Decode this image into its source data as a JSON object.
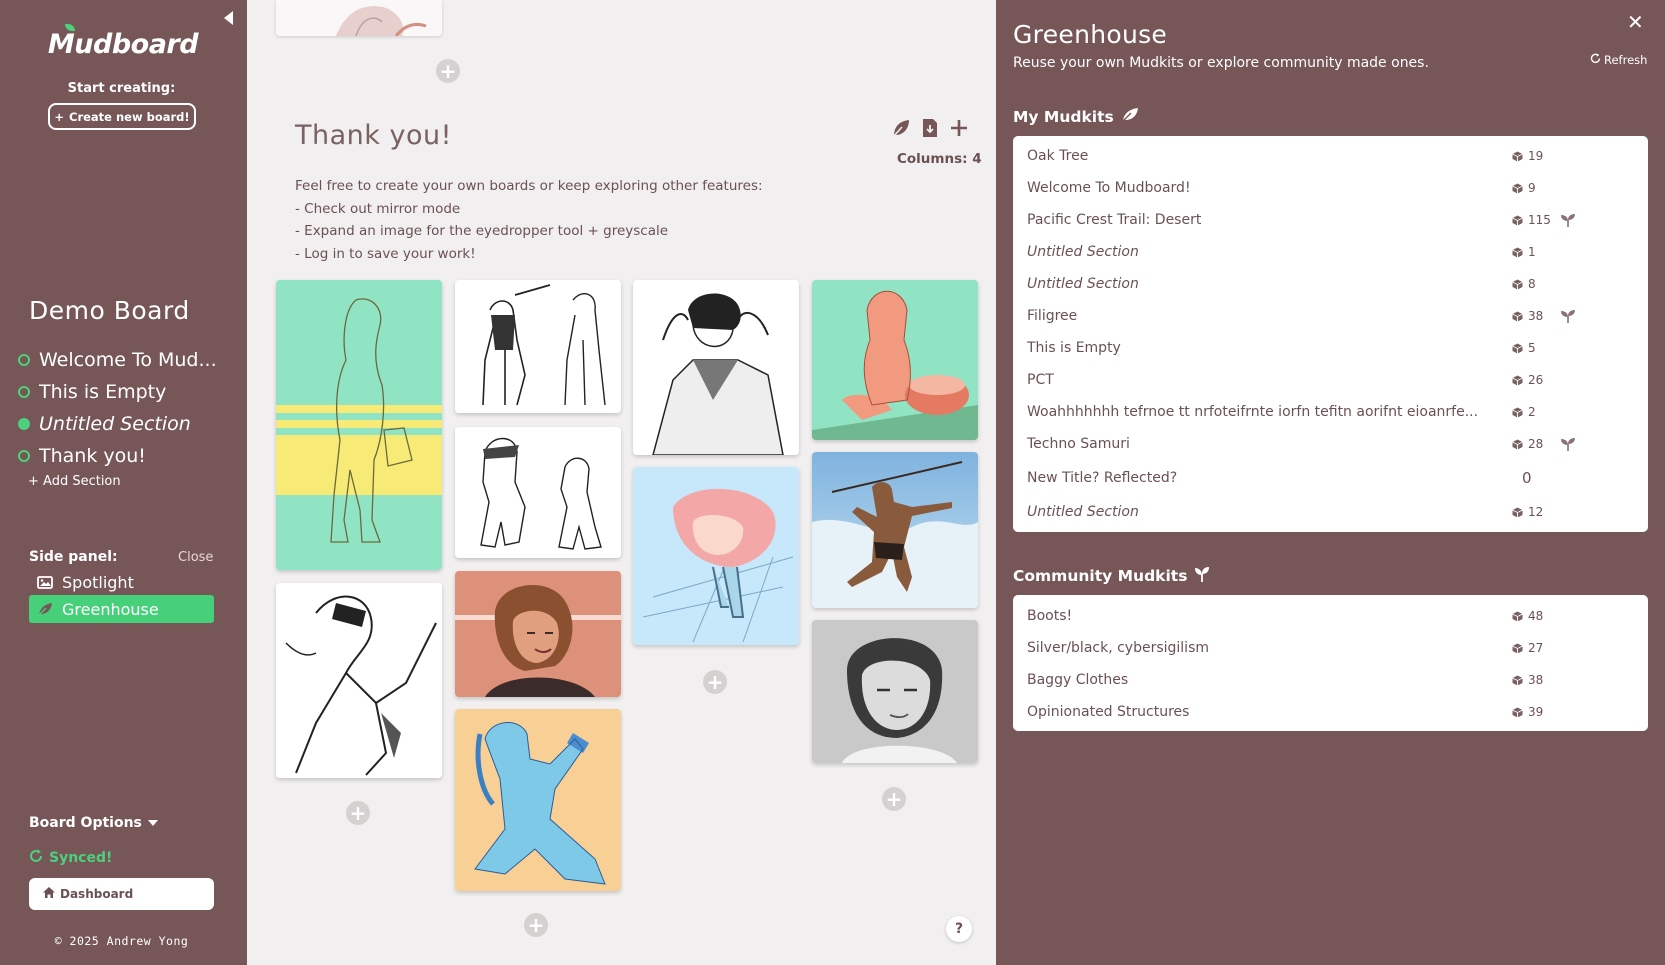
{
  "sidebar": {
    "logo_text": "Mudboard",
    "start_creating": "Start creating:",
    "create_button": "Create new board!",
    "board_title": "Demo Board",
    "sections": [
      {
        "label": "Welcome To Mud...",
        "state": "empty",
        "italic": false
      },
      {
        "label": "This is Empty",
        "state": "empty",
        "italic": false
      },
      {
        "label": "Untitled Section",
        "state": "filled",
        "italic": true
      },
      {
        "label": "Thank you!",
        "state": "empty",
        "italic": false
      }
    ],
    "add_section": "+ Add Section",
    "side_panel_label": "Side panel:",
    "side_panel_close": "Close",
    "panel_items": [
      {
        "label": "Spotlight",
        "icon": "image-icon",
        "active": false
      },
      {
        "label": "Greenhouse",
        "icon": "leaf-icon",
        "active": true
      }
    ],
    "board_options": "Board Options",
    "synced": "Synced!",
    "dashboard": "Dashboard",
    "copyright": "© 2025 Andrew Yong"
  },
  "main": {
    "section_title": "Thank you!",
    "description_lines": [
      "Feel free to create your own boards or keep exploring other features:",
      "- Check out mirror mode",
      "- Expand an image for the eyedropper tool + greyscale",
      "- Log in to save your work!"
    ],
    "columns_label": "Columns: 4",
    "help": "?",
    "accent_colors": {
      "mint": "#90e4c4",
      "yellow": "#f7ea76",
      "peach": "#f8cf95",
      "terracotta": "#dd907a",
      "sky": "#c7e8fb",
      "greenhouse_green": "#45d079"
    }
  },
  "greenhouse": {
    "title": "Greenhouse",
    "subtitle": "Reuse your own Mudkits or explore community made ones.",
    "refresh": "Refresh",
    "my_heading": "My Mudkits",
    "my_mudkits": [
      {
        "name": "Oak Tree",
        "count": "19",
        "italic": false,
        "sprout": false
      },
      {
        "name": "Welcome To Mudboard!",
        "count": "9",
        "italic": false,
        "sprout": false
      },
      {
        "name": "Pacific Crest Trail: Desert",
        "count": "115",
        "italic": false,
        "sprout": true
      },
      {
        "name": "Untitled Section",
        "count": "1",
        "italic": true,
        "sprout": false
      },
      {
        "name": "Untitled Section",
        "count": "8",
        "italic": true,
        "sprout": false
      },
      {
        "name": "Filigree",
        "count": "38",
        "italic": false,
        "sprout": true
      },
      {
        "name": "This is Empty",
        "count": "5",
        "italic": false,
        "sprout": false
      },
      {
        "name": "PCT",
        "count": "26",
        "italic": false,
        "sprout": false
      },
      {
        "name": "Woahhhhhhh tefrnoe tt nrfoteifrnte iorfn tefitn aorifnt eioanrfe...",
        "count": "2",
        "italic": false,
        "sprout": false
      },
      {
        "name": "Techno Samuri",
        "count": "28",
        "italic": false,
        "sprout": true
      },
      {
        "name": "New Title? Reflected?",
        "count": "0",
        "italic": false,
        "sprout": false,
        "no_cube": true
      },
      {
        "name": "Untitled Section",
        "count": "12",
        "italic": true,
        "sprout": false
      }
    ],
    "community_heading": "Community Mudkits",
    "community_mudkits": [
      {
        "name": "Boots!",
        "count": "48"
      },
      {
        "name": "Silver/black, cybersigilism",
        "count": "27"
      },
      {
        "name": "Baggy Clothes",
        "count": "38"
      },
      {
        "name": "Opinionated Structures",
        "count": "39"
      }
    ]
  }
}
